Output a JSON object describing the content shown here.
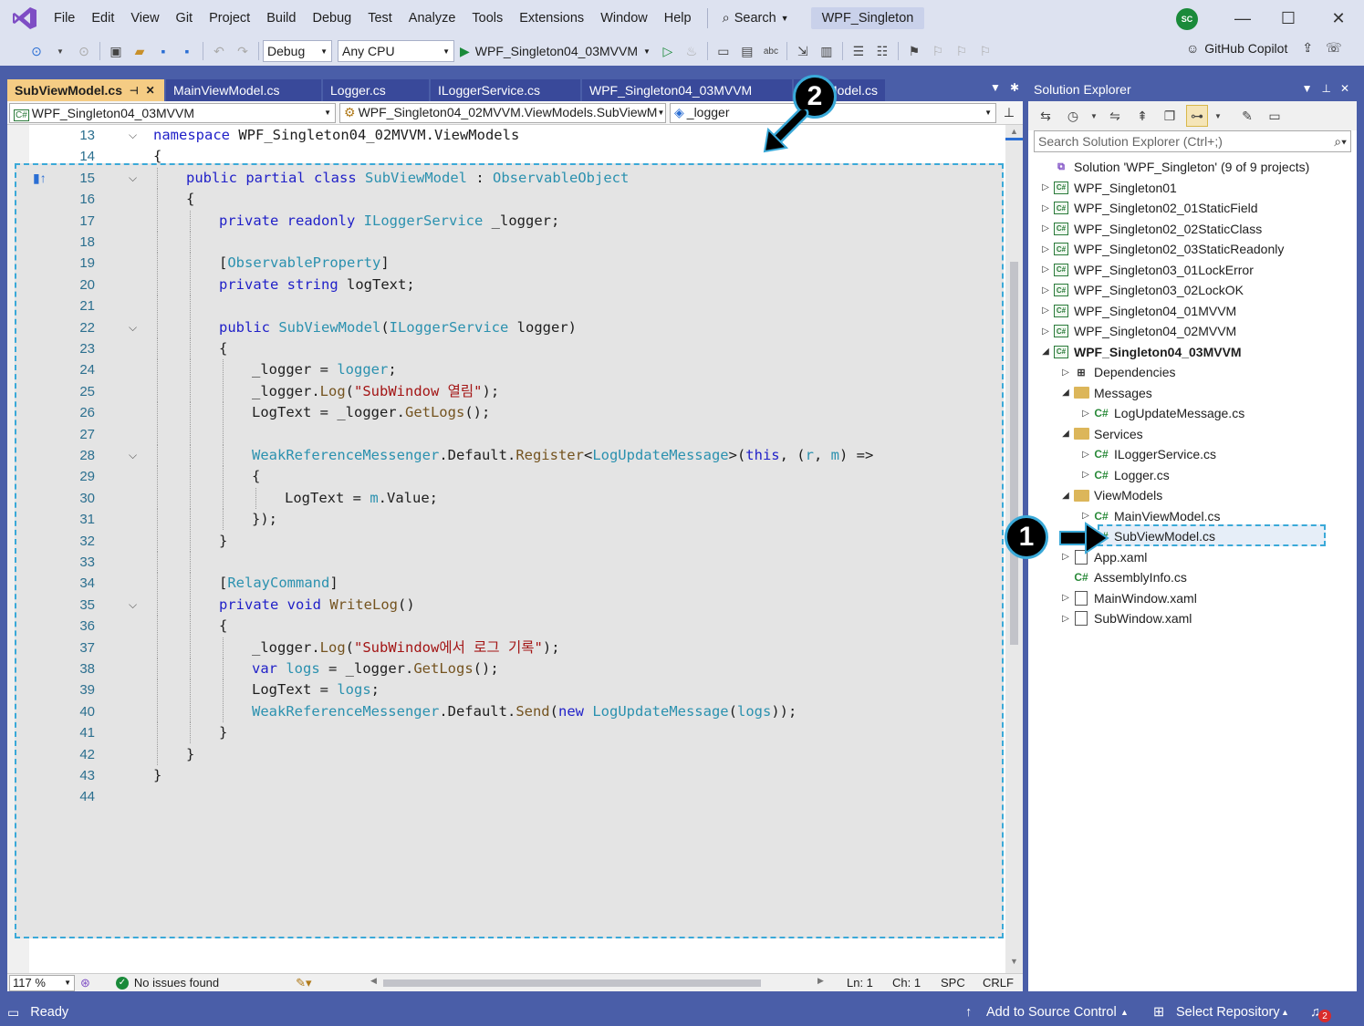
{
  "menu": {
    "items": [
      "File",
      "Edit",
      "View",
      "Git",
      "Project",
      "Build",
      "Debug",
      "Test",
      "Analyze",
      "Tools",
      "Extensions",
      "Window",
      "Help"
    ],
    "search_label": "Search",
    "solution_name": "WPF_Singleton",
    "avatar_initials": "SC"
  },
  "toolbar": {
    "config": "Debug",
    "platform": "Any CPU",
    "run_target": "WPF_Singleton04_03MVVM",
    "copilot_label": "GitHub Copilot"
  },
  "tabs": [
    {
      "label": "SubViewModel.cs",
      "active": true
    },
    {
      "label": "MainViewModel.cs",
      "active": false
    },
    {
      "label": "Logger.cs",
      "active": false
    },
    {
      "label": "ILoggerService.cs",
      "active": false
    },
    {
      "label": "WPF_Singleton04_03MVVM",
      "active": false
    },
    {
      "label": "wModel.cs",
      "active": false
    }
  ],
  "nav_bar": {
    "project": "WPF_Singleton04_03MVVM",
    "type": "WPF_Singleton04_02MVVM.ViewModels.SubViewM",
    "member": "_logger"
  },
  "code_lines": [
    {
      "n": "13",
      "fold": "v",
      "indent": 0,
      "html": "<span class=\"kw\">namespace</span> WPF_Singleton04_02MVVM.ViewModels"
    },
    {
      "n": "14",
      "fold": "",
      "indent": 0,
      "html": "{"
    },
    {
      "n": "15",
      "fold": "v",
      "indent": 1,
      "html": "<span class=\"kw\">public</span> <span class=\"kw\">partial</span> <span class=\"kw\">class</span> <span class=\"ty\">SubViewModel</span> : <span class=\"ty\">ObservableObject</span>"
    },
    {
      "n": "16",
      "fold": "",
      "indent": 1,
      "html": "{"
    },
    {
      "n": "17",
      "fold": "",
      "indent": 2,
      "html": "<span class=\"kw\">private</span> <span class=\"kw\">readonly</span> <span class=\"ty\">ILoggerService</span> _logger;"
    },
    {
      "n": "18",
      "fold": "",
      "indent": 2,
      "html": ""
    },
    {
      "n": "19",
      "fold": "",
      "indent": 2,
      "html": "[<span class=\"attr\">ObservableProperty</span>]"
    },
    {
      "n": "20",
      "fold": "",
      "indent": 2,
      "html": "<span class=\"kw\">private</span> <span class=\"kw\">string</span> logText;"
    },
    {
      "n": "21",
      "fold": "",
      "indent": 2,
      "html": ""
    },
    {
      "n": "22",
      "fold": "v",
      "indent": 2,
      "html": "<span class=\"kw\">public</span> <span class=\"ty\">SubViewModel</span>(<span class=\"ty\">ILoggerService</span> logger)"
    },
    {
      "n": "23",
      "fold": "",
      "indent": 2,
      "html": "{"
    },
    {
      "n": "24",
      "fold": "",
      "indent": 3,
      "html": "_logger = <span class=\"ty\">logger</span>;"
    },
    {
      "n": "25",
      "fold": "",
      "indent": 3,
      "html": "_logger.<span class=\"mth\">Log</span>(<span class=\"str\">\"SubWindow 열림\"</span>);"
    },
    {
      "n": "26",
      "fold": "",
      "indent": 3,
      "html": "LogText = _logger.<span class=\"mth\">GetLogs</span>();"
    },
    {
      "n": "27",
      "fold": "",
      "indent": 3,
      "html": ""
    },
    {
      "n": "28",
      "fold": "v",
      "indent": 3,
      "html": "<span class=\"ty\">WeakReferenceMessenger</span>.Default.<span class=\"mth\">Register</span>&lt;<span class=\"ty\">LogUpdateMessage</span>&gt;(<span class=\"kw\">this</span>, (<span class=\"ty\">r</span>, <span class=\"ty\">m</span>) =&gt;"
    },
    {
      "n": "29",
      "fold": "",
      "indent": 3,
      "html": "{"
    },
    {
      "n": "30",
      "fold": "",
      "indent": 4,
      "html": "LogText = <span class=\"ty\">m</span>.Value;"
    },
    {
      "n": "31",
      "fold": "",
      "indent": 3,
      "html": "});"
    },
    {
      "n": "32",
      "fold": "",
      "indent": 2,
      "html": "}"
    },
    {
      "n": "33",
      "fold": "",
      "indent": 2,
      "html": ""
    },
    {
      "n": "34",
      "fold": "",
      "indent": 2,
      "html": "[<span class=\"attr\">RelayCommand</span>]"
    },
    {
      "n": "35",
      "fold": "v",
      "indent": 2,
      "html": "<span class=\"kw\">private</span> <span class=\"kw\">void</span> <span class=\"mth\">WriteLog</span>()"
    },
    {
      "n": "36",
      "fold": "",
      "indent": 2,
      "html": "{"
    },
    {
      "n": "37",
      "fold": "",
      "indent": 3,
      "html": "_logger.<span class=\"mth\">Log</span>(<span class=\"str\">\"SubWindow에서 로그 기록\"</span>);"
    },
    {
      "n": "38",
      "fold": "",
      "indent": 3,
      "html": "<span class=\"kw\">var</span> <span class=\"ty\">logs</span> = _logger.<span class=\"mth\">GetLogs</span>();"
    },
    {
      "n": "39",
      "fold": "",
      "indent": 3,
      "html": "LogText = <span class=\"ty\">logs</span>;"
    },
    {
      "n": "40",
      "fold": "",
      "indent": 3,
      "html": "<span class=\"ty\">WeakReferenceMessenger</span>.Default.<span class=\"mth\">Send</span>(<span class=\"kw\">new</span> <span class=\"ty\">LogUpdateMessage</span>(<span class=\"ty\">logs</span>));"
    },
    {
      "n": "41",
      "fold": "",
      "indent": 2,
      "html": "}"
    },
    {
      "n": "42",
      "fold": "",
      "indent": 1,
      "html": "}"
    },
    {
      "n": "43",
      "fold": "",
      "indent": 0,
      "html": "}"
    },
    {
      "n": "44",
      "fold": "",
      "indent": 0,
      "html": ""
    }
  ],
  "editor_status": {
    "zoom": "117 %",
    "issues": "No issues found",
    "line": "Ln: 1",
    "col": "Ch: 1",
    "spacing": "SPC",
    "eol": "CRLF"
  },
  "solution_explorer": {
    "title": "Solution Explorer",
    "search_placeholder": "Search Solution Explorer (Ctrl+;)",
    "items": [
      {
        "label": "Solution 'WPF_Singleton' (9 of 9 projects)",
        "level": 0,
        "exp": "",
        "icon": "solution-icon",
        "bold": false
      },
      {
        "label": "WPF_Singleton01",
        "level": 0,
        "exp": "▷",
        "icon": "csharp-project-icon",
        "bold": false
      },
      {
        "label": "WPF_Singleton02_01StaticField",
        "level": 0,
        "exp": "▷",
        "icon": "csharp-project-icon",
        "bold": false
      },
      {
        "label": "WPF_Singleton02_02StaticClass",
        "level": 0,
        "exp": "▷",
        "icon": "csharp-project-icon",
        "bold": false
      },
      {
        "label": "WPF_Singleton02_03StaticReadonly",
        "level": 0,
        "exp": "▷",
        "icon": "csharp-project-icon",
        "bold": false
      },
      {
        "label": "WPF_Singleton03_01LockError",
        "level": 0,
        "exp": "▷",
        "icon": "csharp-project-icon",
        "bold": false
      },
      {
        "label": "WPF_Singleton03_02LockOK",
        "level": 0,
        "exp": "▷",
        "icon": "csharp-project-icon",
        "bold": false
      },
      {
        "label": "WPF_Singleton04_01MVVM",
        "level": 0,
        "exp": "▷",
        "icon": "csharp-project-icon",
        "bold": false
      },
      {
        "label": "WPF_Singleton04_02MVVM",
        "level": 0,
        "exp": "▷",
        "icon": "csharp-project-icon",
        "bold": false
      },
      {
        "label": "WPF_Singleton04_03MVVM",
        "level": 0,
        "exp": "◢",
        "icon": "csharp-project-icon",
        "bold": true
      },
      {
        "label": "Dependencies",
        "level": 1,
        "exp": "▷",
        "icon": "dependencies-icon",
        "bold": false
      },
      {
        "label": "Messages",
        "level": 1,
        "exp": "◢",
        "icon": "folder-icon",
        "bold": false
      },
      {
        "label": "LogUpdateMessage.cs",
        "level": 2,
        "exp": "▷",
        "icon": "csharp-file-icon",
        "bold": false
      },
      {
        "label": "Services",
        "level": 1,
        "exp": "◢",
        "icon": "folder-icon",
        "bold": false
      },
      {
        "label": "ILoggerService.cs",
        "level": 2,
        "exp": "▷",
        "icon": "csharp-file-icon",
        "bold": false
      },
      {
        "label": "Logger.cs",
        "level": 2,
        "exp": "▷",
        "icon": "csharp-file-icon",
        "bold": false
      },
      {
        "label": "ViewModels",
        "level": 1,
        "exp": "◢",
        "icon": "folder-icon",
        "bold": false
      },
      {
        "label": "MainViewModel.cs",
        "level": 2,
        "exp": "▷",
        "icon": "csharp-file-icon",
        "bold": false
      },
      {
        "label": "SubViewModel.cs",
        "level": 2,
        "exp": "",
        "icon": "csharp-file-icon",
        "bold": false
      },
      {
        "label": "App.xaml",
        "level": 1,
        "exp": "▷",
        "icon": "xaml-file-icon",
        "bold": false
      },
      {
        "label": "AssemblyInfo.cs",
        "level": 1,
        "exp": "",
        "icon": "csharp-file-icon",
        "bold": false
      },
      {
        "label": "MainWindow.xaml",
        "level": 1,
        "exp": "▷",
        "icon": "xaml-file-icon",
        "bold": false
      },
      {
        "label": "SubWindow.xaml",
        "level": 1,
        "exp": "▷",
        "icon": "xaml-file-icon",
        "bold": false
      }
    ]
  },
  "statusbar": {
    "ready": "Ready",
    "source_control": "Add to Source Control",
    "repository": "Select Repository",
    "notifications": "2"
  },
  "callouts": {
    "one": "1",
    "two": "2"
  },
  "colors": {
    "accent": "#4a5ea8",
    "active_tab": "#f5cc84",
    "highlight_border": "#3aa9d8"
  }
}
